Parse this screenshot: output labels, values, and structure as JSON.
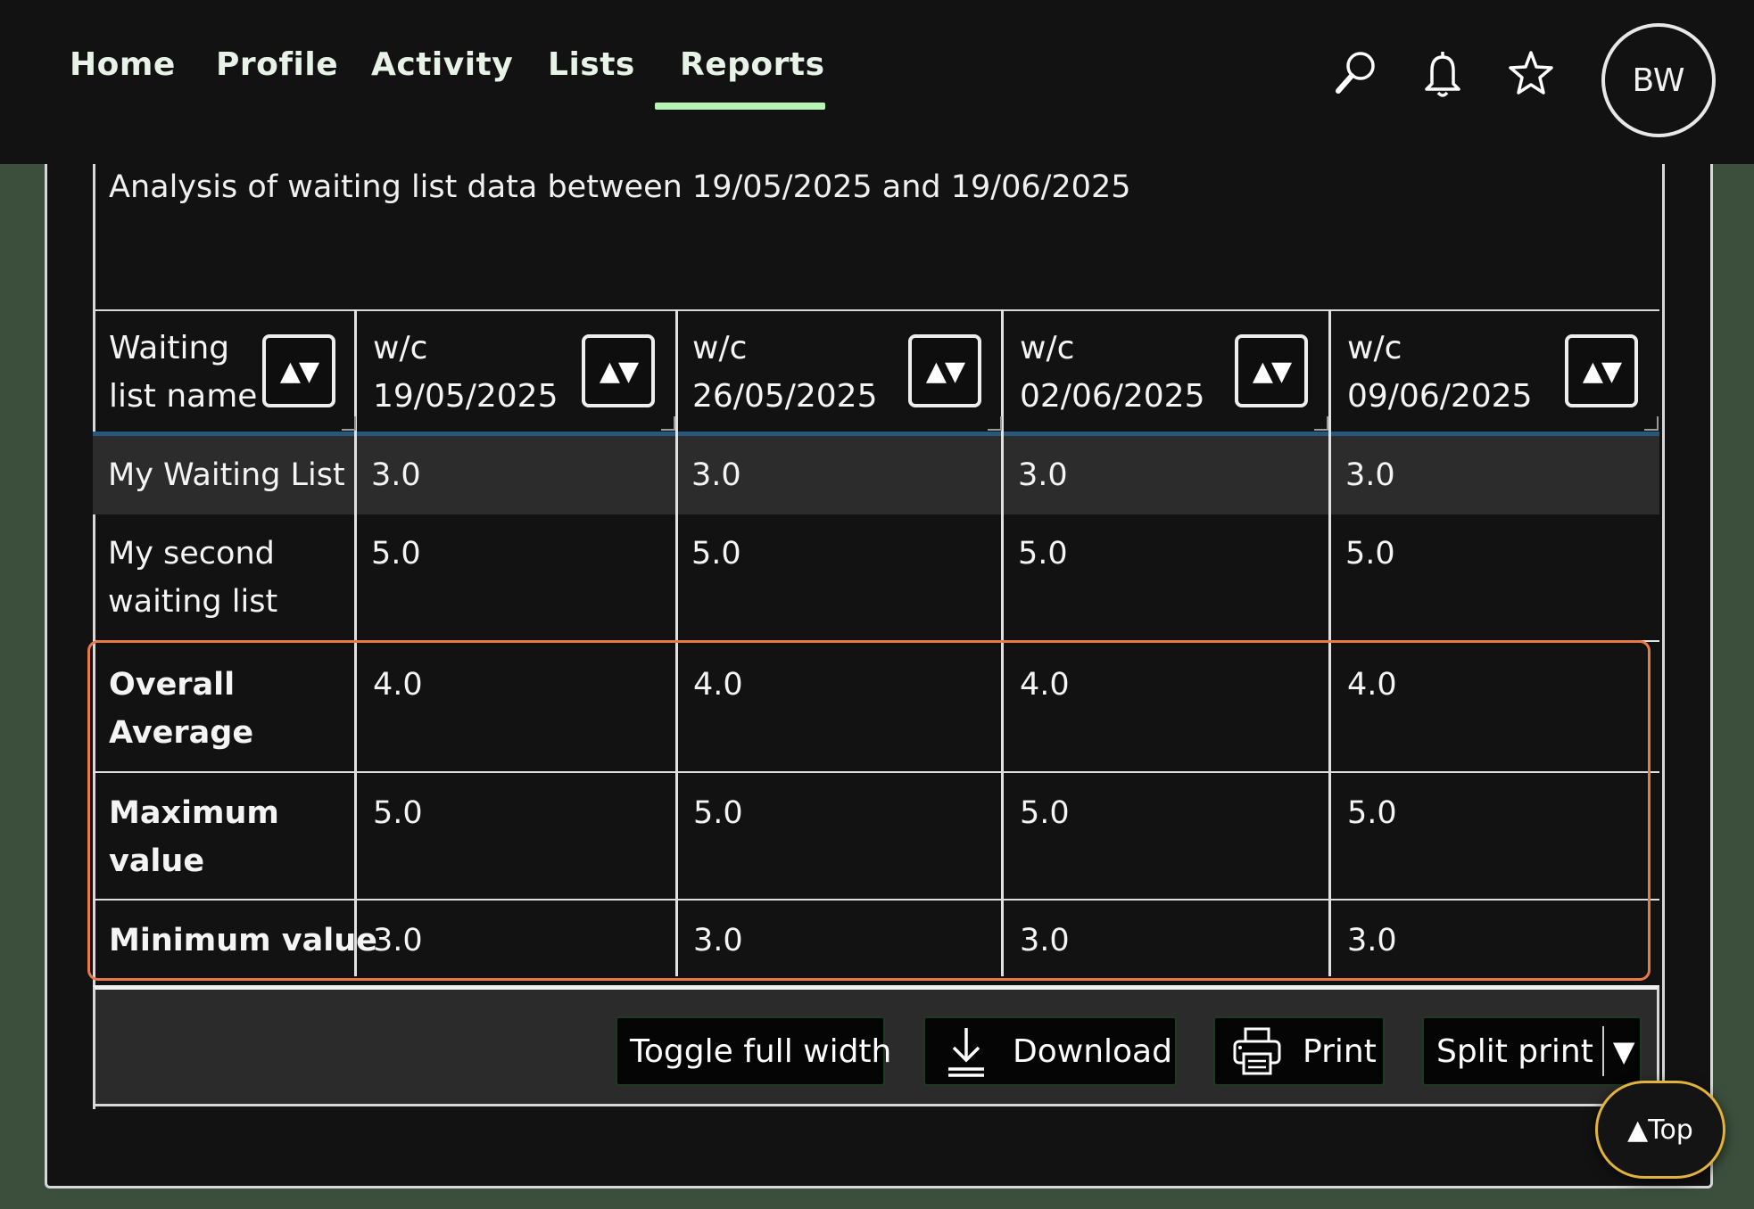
{
  "nav": {
    "items": [
      "Home",
      "Profile",
      "Activity",
      "Lists",
      "Reports"
    ],
    "active": "Reports"
  },
  "user": {
    "initials": "BW"
  },
  "report": {
    "caption": "Analysis of waiting list data between 19/05/2025 and 19/06/2025",
    "table": {
      "headers": [
        "Waiting list name",
        "w/c 19/05/2025",
        "w/c 26/05/2025",
        "w/c 02/06/2025",
        "w/c 09/06/2025"
      ],
      "header_lines": [
        [
          "Waiting",
          "list name"
        ],
        [
          "w/c",
          "19/05/2025"
        ],
        [
          "w/c",
          "26/05/2025"
        ],
        [
          "w/c",
          "02/06/2025"
        ],
        [
          "w/c",
          "09/06/2025"
        ]
      ],
      "sort_symbol": "▲▼",
      "rows": [
        {
          "label_lines": [
            "My Waiting List"
          ],
          "values": [
            "3.0",
            "3.0",
            "3.0",
            "3.0"
          ]
        },
        {
          "label_lines": [
            "My second",
            "waiting list"
          ],
          "values": [
            "5.0",
            "5.0",
            "5.0",
            "5.0"
          ]
        }
      ],
      "summary_rows": [
        {
          "label_lines": [
            "Overall",
            "Average"
          ],
          "values": [
            "4.0",
            "4.0",
            "4.0",
            "4.0"
          ]
        },
        {
          "label_lines": [
            "Maximum",
            "value"
          ],
          "values": [
            "5.0",
            "5.0",
            "5.0",
            "5.0"
          ]
        },
        {
          "label_lines": [
            "Minimum value"
          ],
          "values": [
            "3.0",
            "3.0",
            "3.0",
            "3.0"
          ]
        }
      ]
    }
  },
  "actions": {
    "toggle_full_width": "Toggle full width",
    "download": "Download",
    "print": "Print",
    "split_print": "Split print",
    "split_print_arrow": "▼"
  },
  "back_to_top": "▲Top",
  "colors": {
    "page_background": "#3c4f3d",
    "panel_background": "#121212",
    "nav_active_underline": "#b7f5b5",
    "summary_highlight": "#e87a46",
    "top_button_border": "#e2b23a",
    "header_rule": "#27577a"
  },
  "icons": {
    "search": "search-icon",
    "notifications": "bell-icon",
    "favourites": "star-icon",
    "download": "download-icon",
    "print": "printer-icon"
  }
}
